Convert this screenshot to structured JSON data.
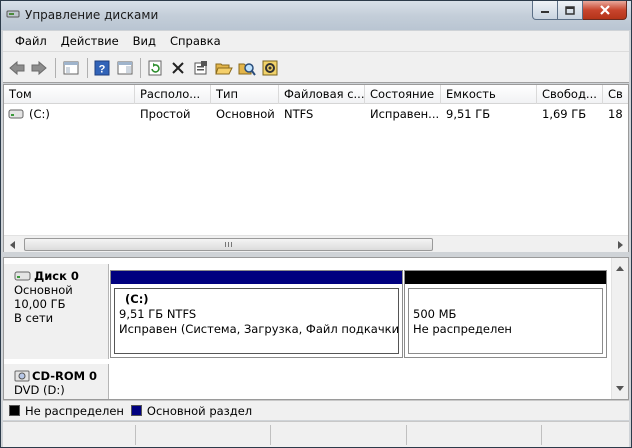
{
  "window": {
    "title": "Управление дисками"
  },
  "menu": [
    "Файл",
    "Действие",
    "Вид",
    "Справка"
  ],
  "toolbar": {
    "icons": [
      "back-icon",
      "forward-icon",
      "console-tree-icon",
      "help-icon",
      "properties-panel-icon",
      "refresh-icon",
      "delete-icon",
      "properties-icon",
      "open-folder-icon",
      "explore-icon",
      "settings-icon"
    ]
  },
  "volumes": {
    "columns": [
      "Том",
      "Располо...",
      "Тип",
      "Файловая с...",
      "Состояние",
      "Емкость",
      "Свобод...",
      "Св"
    ],
    "rows": [
      {
        "name": "(C:)",
        "layout": "Простой",
        "type": "Основной",
        "fs": "NTFS",
        "status": "Исправен...",
        "capacity": "9,51 ГБ",
        "free": "1,69 ГБ",
        "free_pct": "18"
      }
    ]
  },
  "disks": [
    {
      "name": "Диск 0",
      "kind": "Основной",
      "size": "10,00 ГБ",
      "state": "В сети",
      "partitions": [
        {
          "label": "(C:)",
          "size_fs": "9,51 ГБ NTFS",
          "status": "Исправен (Система, Загрузка, Файл подкачки, Акти",
          "color": "#00007f"
        },
        {
          "label": "",
          "size_fs": "500 МБ",
          "status": "Не распределен",
          "color": "#000000"
        }
      ]
    },
    {
      "name": "CD-ROM 0",
      "kind": "DVD (D:)"
    }
  ],
  "legend": [
    {
      "label": "Не распределен",
      "color": "#000000"
    },
    {
      "label": "Основной раздел",
      "color": "#00007f"
    }
  ]
}
